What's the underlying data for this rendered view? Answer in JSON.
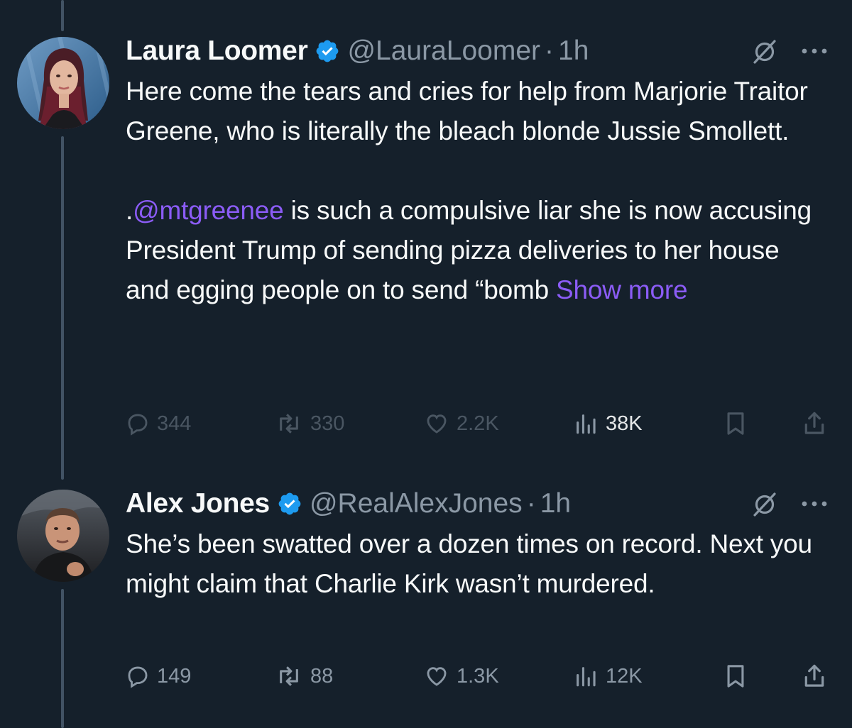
{
  "tweets": [
    {
      "display_name": "Laura Loomer",
      "handle": "@LauraLoomer",
      "separator": "·",
      "time": "1h",
      "paragraphs": [
        "Here come the tears and cries for help from Marjorie Traitor Greene, who is literally the bleach blonde Jussie Smollett."
      ],
      "second_paragraph": {
        "prefix": ".",
        "mention": "@mtgreenee",
        "text": " is such a compulsive liar she is now accusing President Trump of sending pizza deliveries to her house and egging people on to send “bomb ",
        "show_more": "Show more"
      },
      "stats": {
        "replies": "344",
        "reposts": "330",
        "likes": "2.2K",
        "views": "38K"
      }
    },
    {
      "display_name": "Alex Jones",
      "handle": "@RealAlexJones",
      "separator": "·",
      "time": "1h",
      "paragraphs": [
        "She’s been swatted over a dozen times on record. Next you might claim that Charlie Kirk wasn’t murdered."
      ],
      "stats": {
        "replies": "149",
        "reposts": "88",
        "likes": "1.3K",
        "views": "12K"
      }
    }
  ],
  "icons": {
    "verified": "verified-badge-icon",
    "grok": "grok-icon",
    "more": "more-options-icon",
    "reply": "reply-icon",
    "repost": "repost-icon",
    "like": "like-icon",
    "views": "views-icon",
    "bookmark": "bookmark-icon",
    "share": "share-icon"
  },
  "colors": {
    "background": "#15202b",
    "text": "#f7f9f9",
    "muted": "#8b98a5",
    "accent": "#8b5cf6",
    "verified": "#1d9bf0",
    "thread_line": "#425364"
  }
}
